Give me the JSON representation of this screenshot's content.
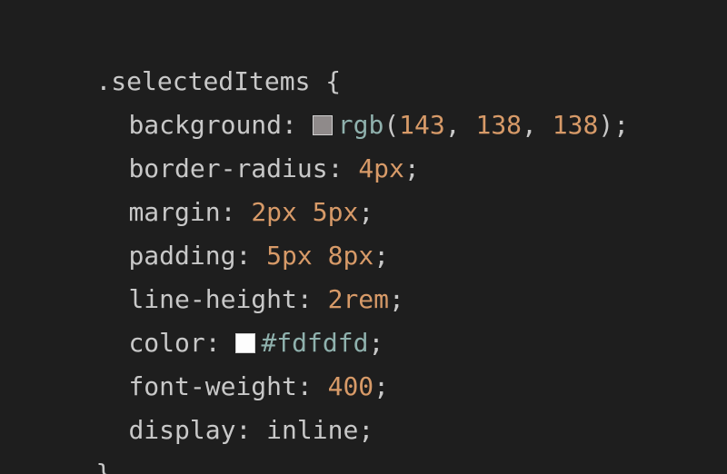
{
  "code": {
    "selector": ".selectedItems",
    "open_brace": " {",
    "close_brace": "}",
    "declarations": [
      {
        "property": "background",
        "swatch_color": "#8f8a8a",
        "fn_name": "rgb",
        "fn_open": "(",
        "args": [
          "143",
          "138",
          "138"
        ],
        "fn_close": ")"
      },
      {
        "property": "border-radius",
        "value": "4px"
      },
      {
        "property": "margin",
        "value": "2px 5px"
      },
      {
        "property": "padding",
        "value": "5px 8px"
      },
      {
        "property": "line-height",
        "value": "2rem"
      },
      {
        "property": "color",
        "swatch_color": "#fdfdfd",
        "value": "#fdfdfd"
      },
      {
        "property": "font-weight",
        "value": "400"
      },
      {
        "property": "display",
        "value": "inline"
      }
    ]
  },
  "theme": {
    "background": "#1e1e1e",
    "text": "#c8c8c8",
    "number": "#d79a68",
    "function": "#8fb1ad"
  }
}
